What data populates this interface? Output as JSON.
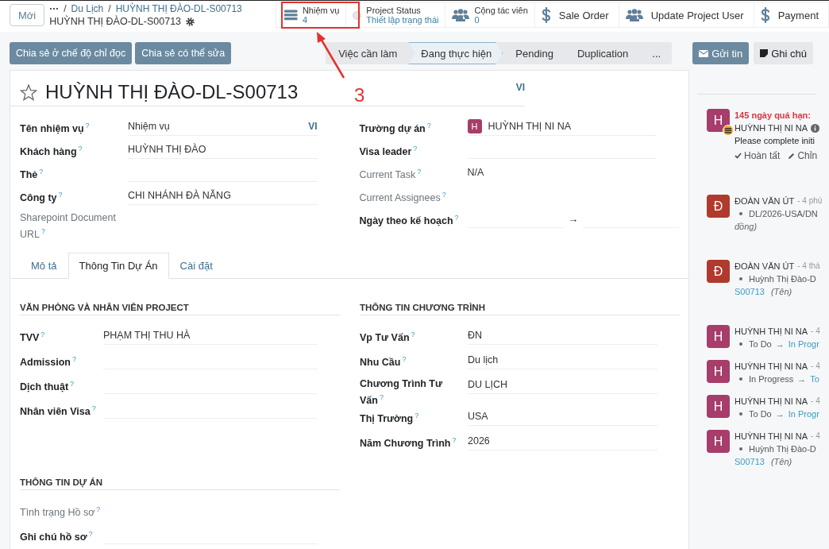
{
  "header": {
    "new_button": "Mới",
    "breadcrumbs": [
      "···",
      "Du Lịch",
      "HUỲNH THỊ ĐÀO-DL-S00713"
    ],
    "separator": "/",
    "record_title": "HUỲNH THỊ ĐÀO-DL-S00713"
  },
  "smart_buttons": [
    {
      "kind": "tasks",
      "label": "Nhiệm vụ",
      "value": "4"
    },
    {
      "kind": "status",
      "label": "Project Status",
      "value": "Thiết lập trạng thái"
    },
    {
      "kind": "people",
      "label": "Cộng tác viên",
      "value": "0"
    },
    {
      "kind": "money",
      "label": "Sale Order"
    },
    {
      "kind": "people",
      "label": "Update Project User"
    },
    {
      "kind": "money",
      "label": "Payment"
    }
  ],
  "share_buttons": [
    "Chia sẻ ở chế độ chỉ đọc",
    "Chia sẻ có thể sửa"
  ],
  "stages": [
    {
      "label": "Việc cần làm",
      "selected": false
    },
    {
      "label": "Đang thực hiện",
      "selected": true
    },
    {
      "label": "Pending",
      "selected": false
    },
    {
      "label": "Duplication",
      "selected": false
    },
    {
      "label": "...",
      "selected": false
    }
  ],
  "chatter_buttons": [
    {
      "kind": "message",
      "label": "Gửi tin",
      "primary": true
    },
    {
      "kind": "note",
      "label": "Ghi chú",
      "primary": false
    }
  ],
  "form": {
    "title": "HUỲNH THỊ ĐÀO-DL-S00713",
    "starred": false,
    "title_lang": "VI",
    "left_fields": [
      {
        "label": "Tên nhiệm vụ",
        "help": "?",
        "value": "Nhiệm vụ",
        "lang": "VI",
        "readonly": false
      },
      {
        "label": "Khách hàng",
        "help": "?",
        "value": "HUỲNH THỊ ĐÀO",
        "readonly": false
      },
      {
        "label": "Thẻ",
        "help": "?",
        "readonly": false
      },
      {
        "label": "Công ty",
        "help": "?",
        "value": "CHI NHÁNH ĐÀ NẴNG",
        "readonly": false
      },
      {
        "label": "Sharepoint Document URL",
        "help": "?",
        "readonly": true
      }
    ],
    "right_fields": [
      {
        "kind": "user",
        "label": "Trường dự án",
        "help": "?",
        "avatar": "H",
        "value": "HUỲNH THỊ NI NA",
        "readonly": false
      },
      {
        "kind": "text",
        "label": "Visa leader",
        "help": "?",
        "readonly": false
      },
      {
        "kind": "text",
        "label": "Current Task",
        "help": "?",
        "value": "N/A",
        "readonly": true
      },
      {
        "kind": "text",
        "label": "Current Assignees",
        "help": "?",
        "readonly": true
      },
      {
        "kind": "daterange",
        "label": "Ngày theo kế hoạch",
        "help": "?",
        "arrow": "→",
        "readonly": false
      }
    ],
    "tabs": [
      {
        "label": "Mô tả",
        "selected": false
      },
      {
        "label": "Thông Tin Dự Án",
        "selected": true
      },
      {
        "label": "Cài đặt",
        "selected": false
      }
    ],
    "groups": [
      {
        "title": "VĂN PHÒNG VÀ NHÂN VIÊN PROJECT",
        "fields": [
          {
            "label": "TVV",
            "help": "?",
            "value": "PHẠM THỊ THU HÀ",
            "readonly": false
          },
          {
            "label": "Admission",
            "help": "?",
            "readonly": false
          },
          {
            "label": "Dịch thuật",
            "help": "?",
            "readonly": false
          },
          {
            "label": "Nhân viên Visa",
            "help": "?",
            "readonly": false
          }
        ]
      },
      {
        "title": "THÔNG TIN CHƯƠNG TRÌNH",
        "fields": [
          {
            "label": "Vp Tư Vấn",
            "help": "?",
            "value": "ĐN",
            "readonly": false
          },
          {
            "label": "Nhu Cầu",
            "help": "?",
            "value": "Du lịch",
            "readonly": false
          },
          {
            "label": "Chương Trình Tư Vấn",
            "help": "?",
            "value": "DU LỊCH",
            "readonly": false
          },
          {
            "label": "Thị Trường",
            "help": "?",
            "value": "USA",
            "readonly": false
          },
          {
            "label": "Năm Chương Trình",
            "help": "?",
            "value": "2026",
            "readonly": false
          }
        ]
      },
      {
        "title": "THÔNG TIN DỰ ÁN",
        "fields": [
          {
            "label": "Tình trạng Hồ sơ",
            "help": "?",
            "readonly": true
          },
          {
            "label": "Ghi chú hồ sơ",
            "help": "?",
            "readonly": false
          }
        ]
      }
    ]
  },
  "chatter": {
    "messages": [
      {
        "kind": "activity",
        "avatar": "H",
        "color": "#a63d6a",
        "overdue": "145 ngày quá hạn:",
        "author": "HUỲNH THỊ NI NA",
        "summary": "Please complete initi",
        "actions": [
          "Hoàn tất",
          "Chỉn"
        ]
      },
      {
        "kind": "log",
        "avatar": "Đ",
        "color": "#b03a2e",
        "author": "ĐOÀN VĂN ÚT",
        "time": "- 4 phú",
        "lines": [
          {
            "kind": "text",
            "text": "DL/2026-USA/DN",
            "field": "đồng)"
          }
        ]
      },
      {
        "kind": "log",
        "avatar": "Đ",
        "color": "#b03a2e",
        "author": "ĐOÀN VĂN ÚT",
        "time": "- 4 thá",
        "lines": [
          {
            "kind": "text",
            "text": "Huỳnh Thị Đào-D",
            "link": "S00713",
            "field": "(Tên)"
          }
        ]
      },
      {
        "kind": "log",
        "avatar": "H",
        "color": "#a63d6a",
        "author": "HUỲNH THỊ NI NA",
        "time": "- 4",
        "lines": [
          {
            "kind": "change",
            "old": "To Do",
            "arrow": "→",
            "new": "In Progr"
          }
        ]
      },
      {
        "kind": "log",
        "avatar": "H",
        "color": "#a63d6a",
        "author": "HUỲNH THỊ NI NA",
        "time": "- 4",
        "lines": [
          {
            "kind": "change",
            "old": "In Progress",
            "arrow": "→",
            "new": "To"
          }
        ]
      },
      {
        "kind": "log",
        "avatar": "H",
        "color": "#a63d6a",
        "author": "HUỲNH THỊ NI NA",
        "time": "- 4",
        "lines": [
          {
            "kind": "change",
            "old": "To Do",
            "arrow": "→",
            "new": "In Progr"
          }
        ]
      },
      {
        "kind": "log",
        "avatar": "H",
        "color": "#a63d6a",
        "author": "HUỲNH THỊ NI NA",
        "time": "- 4",
        "lines": [
          {
            "kind": "text",
            "text": "Huỳnh Thị Đào-D",
            "link": "S00713",
            "field": "(Tên)"
          }
        ]
      }
    ]
  },
  "annotation": {
    "label": "3"
  }
}
